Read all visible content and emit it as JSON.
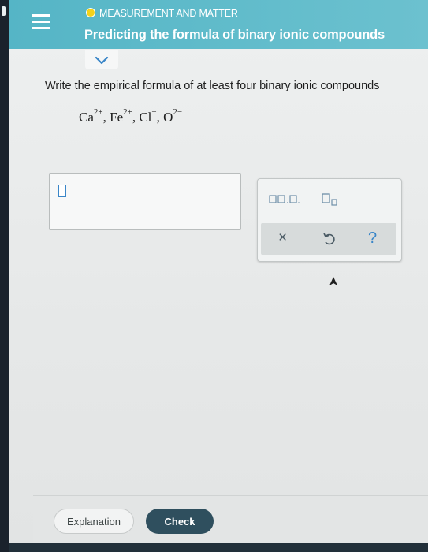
{
  "header": {
    "topic": "MEASUREMENT AND MATTER",
    "title": "Predicting the formula of binary ionic compounds",
    "status_color": "#f3d21a",
    "accent_color": "#5bb8c9"
  },
  "question": {
    "prompt": "Write the empirical formula of at least four binary ionic compounds",
    "ions": [
      {
        "symbol": "Ca",
        "charge": "2+",
        "sep": ", "
      },
      {
        "symbol": "Fe",
        "charge": "2+",
        "sep": ", "
      },
      {
        "symbol": "Cl",
        "charge": "−",
        "sep": ", "
      },
      {
        "symbol": "O",
        "charge": "2−",
        "sep": ""
      }
    ]
  },
  "palette": {
    "clear_symbol": "×",
    "undo_icon": "undo-icon",
    "help_symbol": "?"
  },
  "footer": {
    "explanation_label": "Explanation",
    "check_label": "Check",
    "check_color": "#2f4f5e"
  }
}
